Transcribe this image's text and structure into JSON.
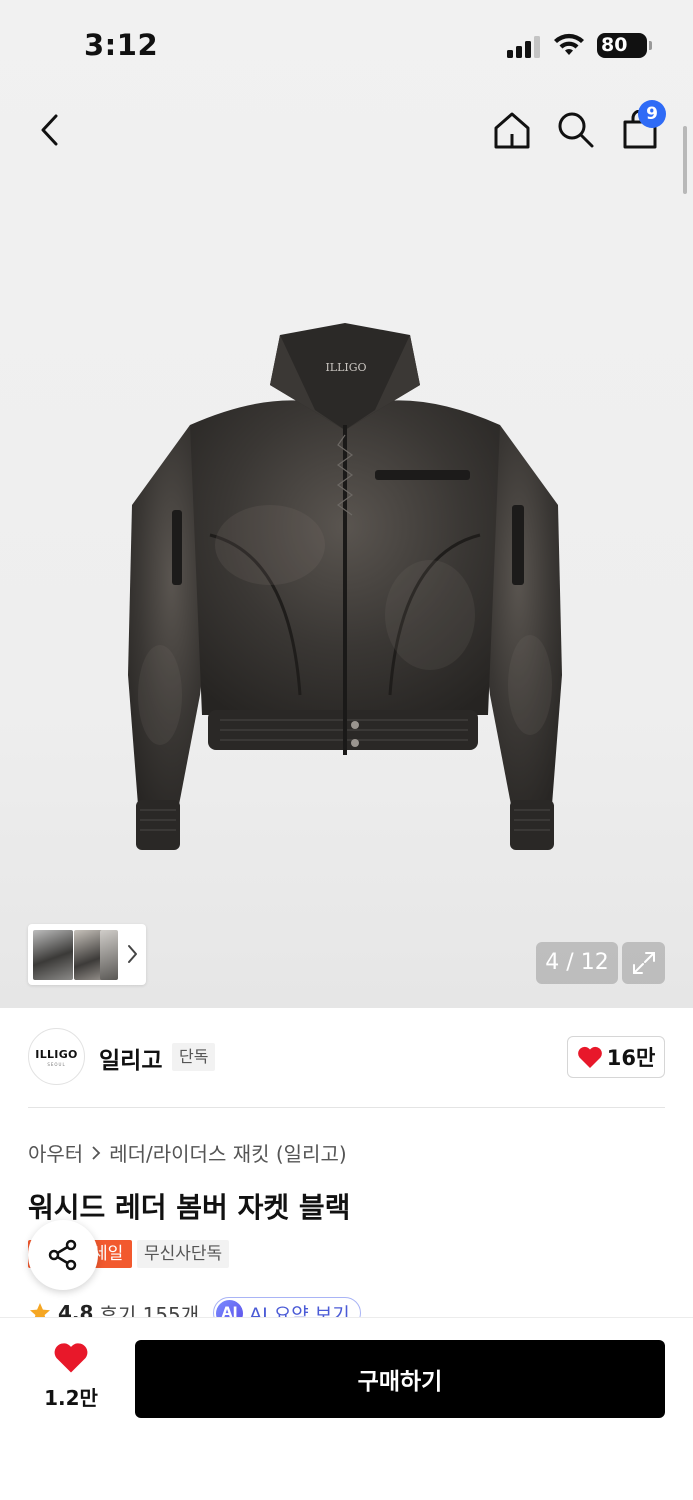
{
  "status_bar": {
    "time": "3:12",
    "battery": "80"
  },
  "nav": {
    "cart_count": "9"
  },
  "gallery": {
    "page_counter": "4 / 12"
  },
  "brand": {
    "logo_text": "ILLIGO",
    "logo_subtext": "SEOUL",
    "name": "일리고",
    "tag": "단독",
    "like_count": "16만"
  },
  "breadcrumb": {
    "level1": "아우터",
    "level2": "레더/라이더스 재킷 (일리고)"
  },
  "product": {
    "title": "워시드 레더 봄버 자켓 블랙",
    "sale_badge": "세일",
    "exclusive_badge": "무신사단독",
    "rating": "4.8",
    "reviews": "후기 155개",
    "ai_summary": "AI 요약 보기"
  },
  "bottom_bar": {
    "like_count": "1.2만",
    "buy_label": "구매하기"
  },
  "colors": {
    "accent_sale": "#f2592e",
    "badge_blue": "#2f6bf6",
    "heart_red": "#e8182a",
    "buy_button": "#000000"
  },
  "icons": [
    "back-icon",
    "home-icon",
    "search-icon",
    "shopping-bag-icon",
    "chevron-right-icon",
    "expand-icon",
    "heart-icon",
    "share-icon",
    "star-icon"
  ]
}
